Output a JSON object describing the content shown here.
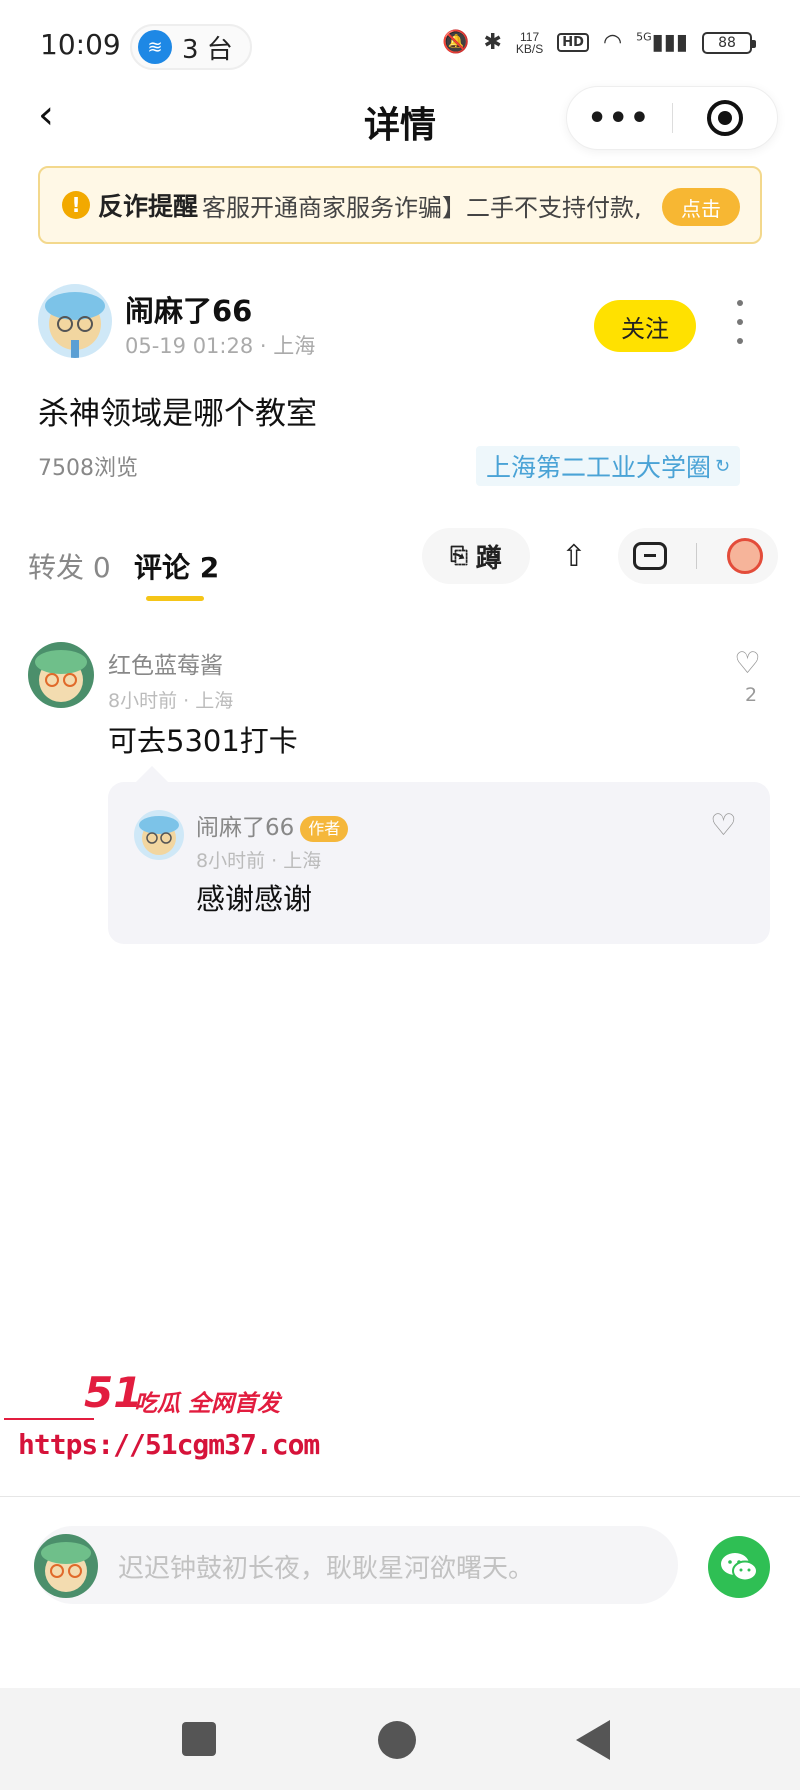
{
  "status_bar": {
    "time": "10:09",
    "pill_text": "3 台",
    "net_speed_value": "117",
    "net_speed_unit": "KB/S",
    "hd": "HD",
    "signal": "5G",
    "battery": "88"
  },
  "nav": {
    "title": "详情",
    "more": "•••"
  },
  "alert": {
    "title": "反诈提醒",
    "text": "客服开通商家服务诈骗】二手不支持付款,",
    "button": "点击"
  },
  "post": {
    "author": "闹麻了66",
    "meta": "05-19 01:28 · 上海",
    "follow": "关注",
    "content": "杀神领域是哪个教室",
    "views": "7508浏览",
    "circle": "上海第二工业大学圈"
  },
  "tabs": {
    "forward": "转发 0",
    "comment": "评论 2"
  },
  "actions": {
    "dun": "蹲"
  },
  "comments": [
    {
      "name": "红色蓝莓酱",
      "meta": "8小时前 · 上海",
      "text": "可去5301打卡",
      "likes": "2",
      "reply": {
        "name": "闹麻了66",
        "badge": "作者",
        "meta": "8小时前 · 上海",
        "text": "感谢感谢"
      }
    }
  ],
  "watermark": {
    "number": "51",
    "tag": "吃瓜 全网首发",
    "url": "https://51cgm37.com"
  },
  "input": {
    "placeholder": "迟迟钟鼓初长夜，耿耿星河欲曙天。"
  },
  "colors": {
    "accent_yellow": "#ffe100",
    "circle_blue": "#4aa3d6",
    "wechat_green": "#2fbf54",
    "watermark_red": "#e21d3f"
  }
}
